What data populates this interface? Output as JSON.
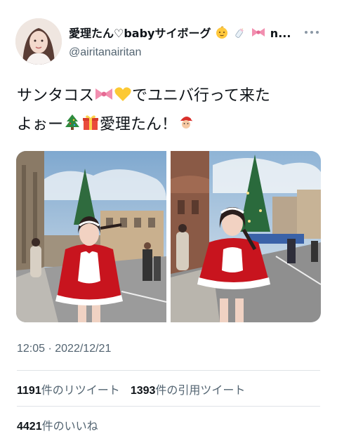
{
  "user": {
    "display_name": "愛理たん♡babyサイボーグ",
    "display_name_suffix": "n...",
    "handle": "@airitanairitan",
    "name_emojis": [
      "baby-face-icon",
      "baby-bottle-icon",
      "ribbon-icon"
    ]
  },
  "tweet": {
    "text_part1": "サンタコス",
    "text_part2": "でユニバ行って来た",
    "text_part3": "よぉー",
    "text_part4": "愛理たん！",
    "emojis": [
      "ribbon-icon",
      "yellow-heart-icon",
      "christmas-tree-icon",
      "gift-icon",
      "santa-icon"
    ]
  },
  "timestamp": "12:05 · 2022/12/21",
  "stats": {
    "retweets_count": "1191",
    "retweets_label": "件のリツイート",
    "quotes_count": "1393",
    "quotes_label": "件の引用ツイート",
    "likes_count": "4421",
    "likes_label": "件のいいね"
  },
  "colors": {
    "text_primary": "#0f1419",
    "text_secondary": "#536471",
    "divider": "#dfe3e7"
  }
}
